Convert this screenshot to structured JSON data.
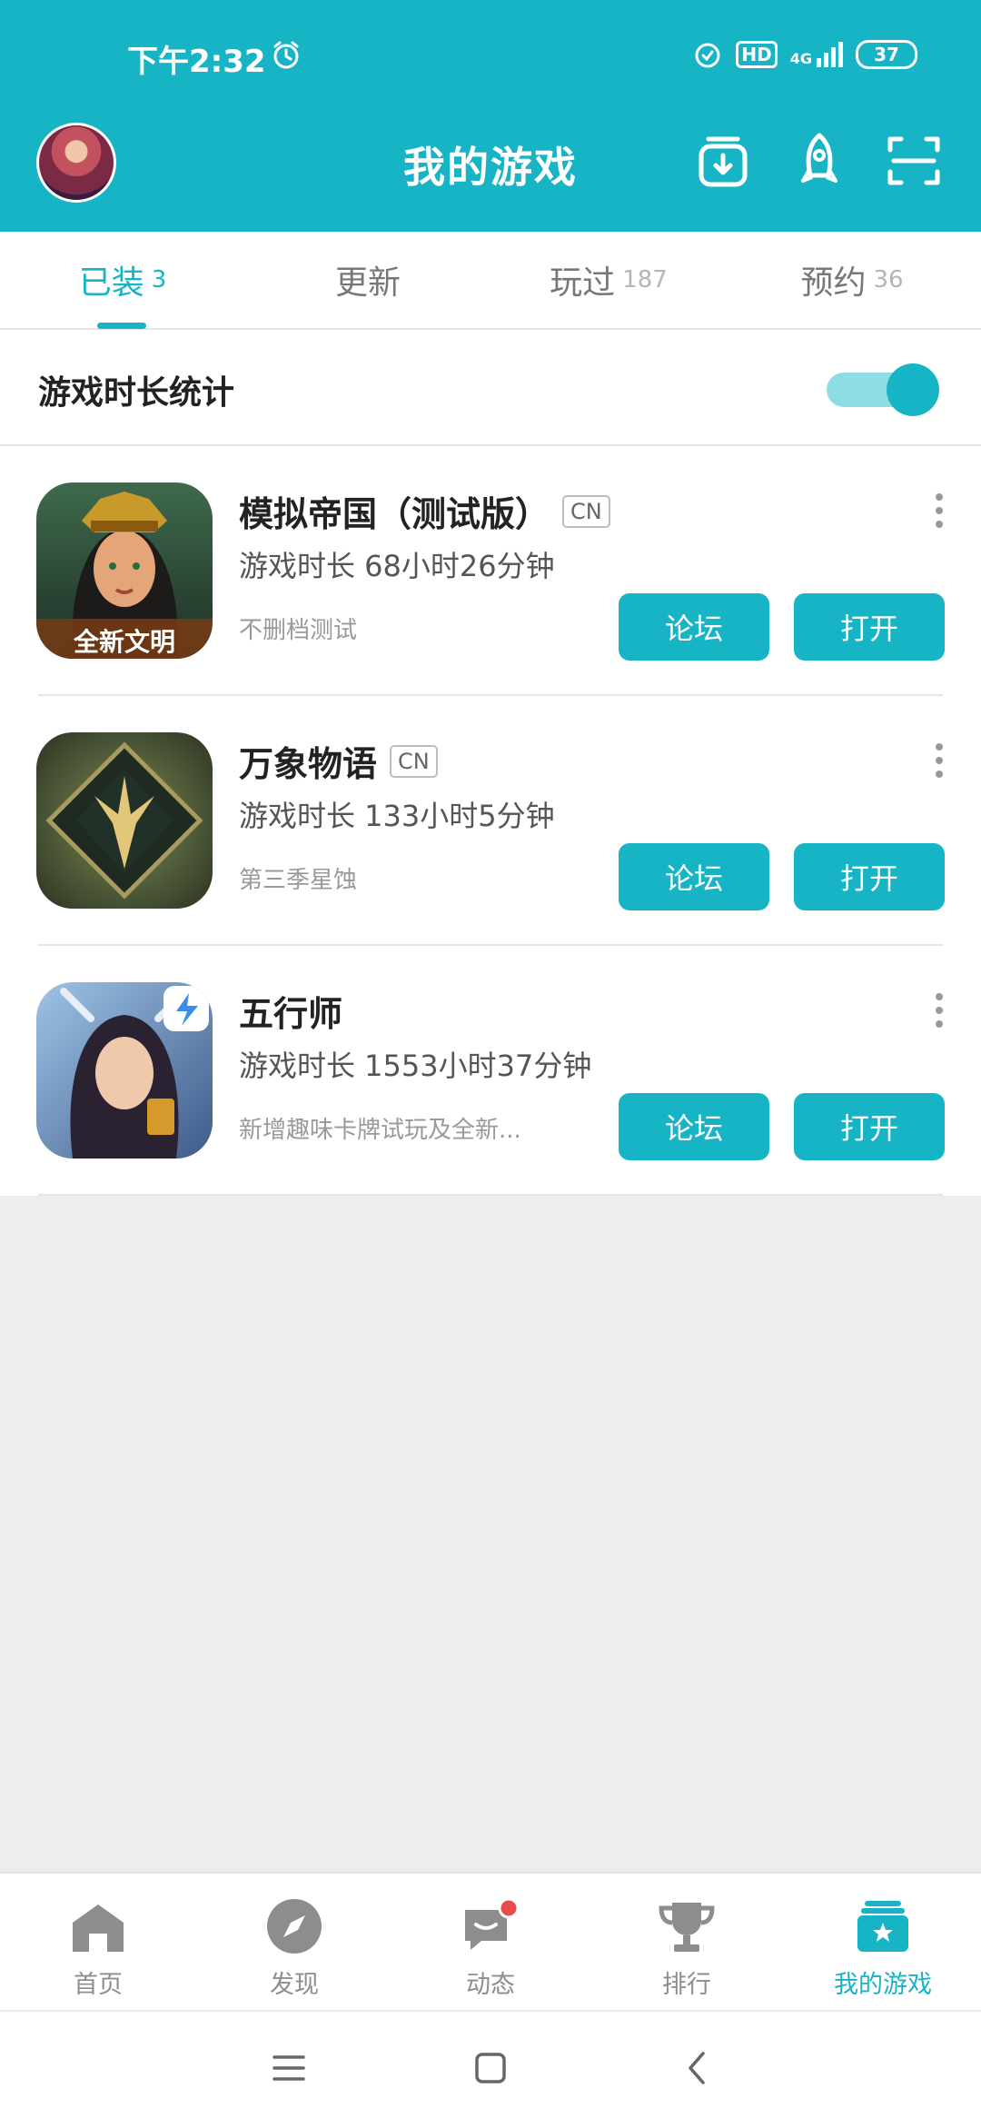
{
  "status_bar": {
    "time": "下午2:32",
    "hd": "HD",
    "network": "4G",
    "battery": "37"
  },
  "header": {
    "title": "我的游戏"
  },
  "tabs": [
    {
      "label": "已装",
      "count": "3"
    },
    {
      "label": "更新",
      "count": ""
    },
    {
      "label": "玩过",
      "count": "187"
    },
    {
      "label": "预约",
      "count": "36"
    }
  ],
  "stats": {
    "label": "游戏时长统计",
    "enabled": true
  },
  "games": [
    {
      "name": "模拟帝国（测试版）",
      "badge": "CN",
      "time": "游戏时长 68小时26分钟",
      "desc": "不删档测试",
      "icon_caption": "全新文明",
      "forum_label": "论坛",
      "open_label": "打开"
    },
    {
      "name": "万象物语",
      "badge": "CN",
      "time": "游戏时长 133小时5分钟",
      "desc": "第三季星蚀",
      "forum_label": "论坛",
      "open_label": "打开"
    },
    {
      "name": "五行师",
      "badge": "",
      "time": "游戏时长 1553小时37分钟",
      "desc": "新增趣味卡牌试玩及全新...",
      "forum_label": "论坛",
      "open_label": "打开"
    }
  ],
  "bottom_nav": [
    {
      "label": "首页",
      "icon": "home-icon"
    },
    {
      "label": "发现",
      "icon": "compass-icon"
    },
    {
      "label": "动态",
      "icon": "chat-icon"
    },
    {
      "label": "排行",
      "icon": "trophy-icon"
    },
    {
      "label": "我的游戏",
      "icon": "my-games-icon",
      "active": true
    }
  ],
  "colors": {
    "accent": "#17b4c6",
    "page_bg": "#ededed",
    "badge_red": "#e84c4c"
  }
}
